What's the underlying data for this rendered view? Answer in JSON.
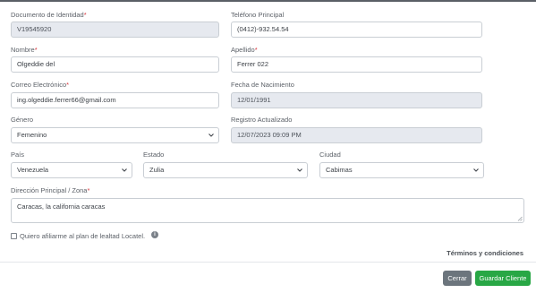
{
  "form": {
    "documento": {
      "label": "Documento de Identidad",
      "required": true,
      "value": "V19545920"
    },
    "telefono": {
      "label": "Teléfono Principal",
      "required": false,
      "value": "(0412)-932.54.54"
    },
    "nombre": {
      "label": "Nombre",
      "required": true,
      "value": "Olgeddie del"
    },
    "apellido": {
      "label": "Apellido",
      "required": true,
      "value": "Ferrer 022"
    },
    "correo": {
      "label": "Correo Electrónico",
      "required": true,
      "value": "ing.olgeddie.ferrer66@gmail.com"
    },
    "nacimiento": {
      "label": "Fecha de Nacimiento",
      "required": false,
      "value": "12/01/1991"
    },
    "genero": {
      "label": "Género",
      "required": false,
      "selected": "Femenino"
    },
    "registro": {
      "label": "Registro Actualizado",
      "required": false,
      "value": "12/07/2023 09:09 PM"
    },
    "pais": {
      "label": "País",
      "required": false,
      "selected": "Venezuela"
    },
    "estado": {
      "label": "Estado",
      "required": false,
      "selected": "Zulia"
    },
    "ciudad": {
      "label": "Ciudad",
      "required": false,
      "selected": "Cabimas"
    },
    "direccion": {
      "label": "Dirección Principal / Zona",
      "required": true,
      "value": "Caracas, la california caracas"
    },
    "lealtad": {
      "label": "Quiero afiliarme al plan de lealtad Locatel.",
      "checked": false
    }
  },
  "info_icon": "info-circle-icon",
  "terms_label": "Términos y condiciones",
  "buttons": {
    "close": "Cerrar",
    "save": "Guardar Cliente"
  },
  "colors": {
    "required": "#d9363e",
    "close_button": "#6c757d",
    "save_button": "#28a745",
    "readonly_bg": "#e6e9ef"
  }
}
